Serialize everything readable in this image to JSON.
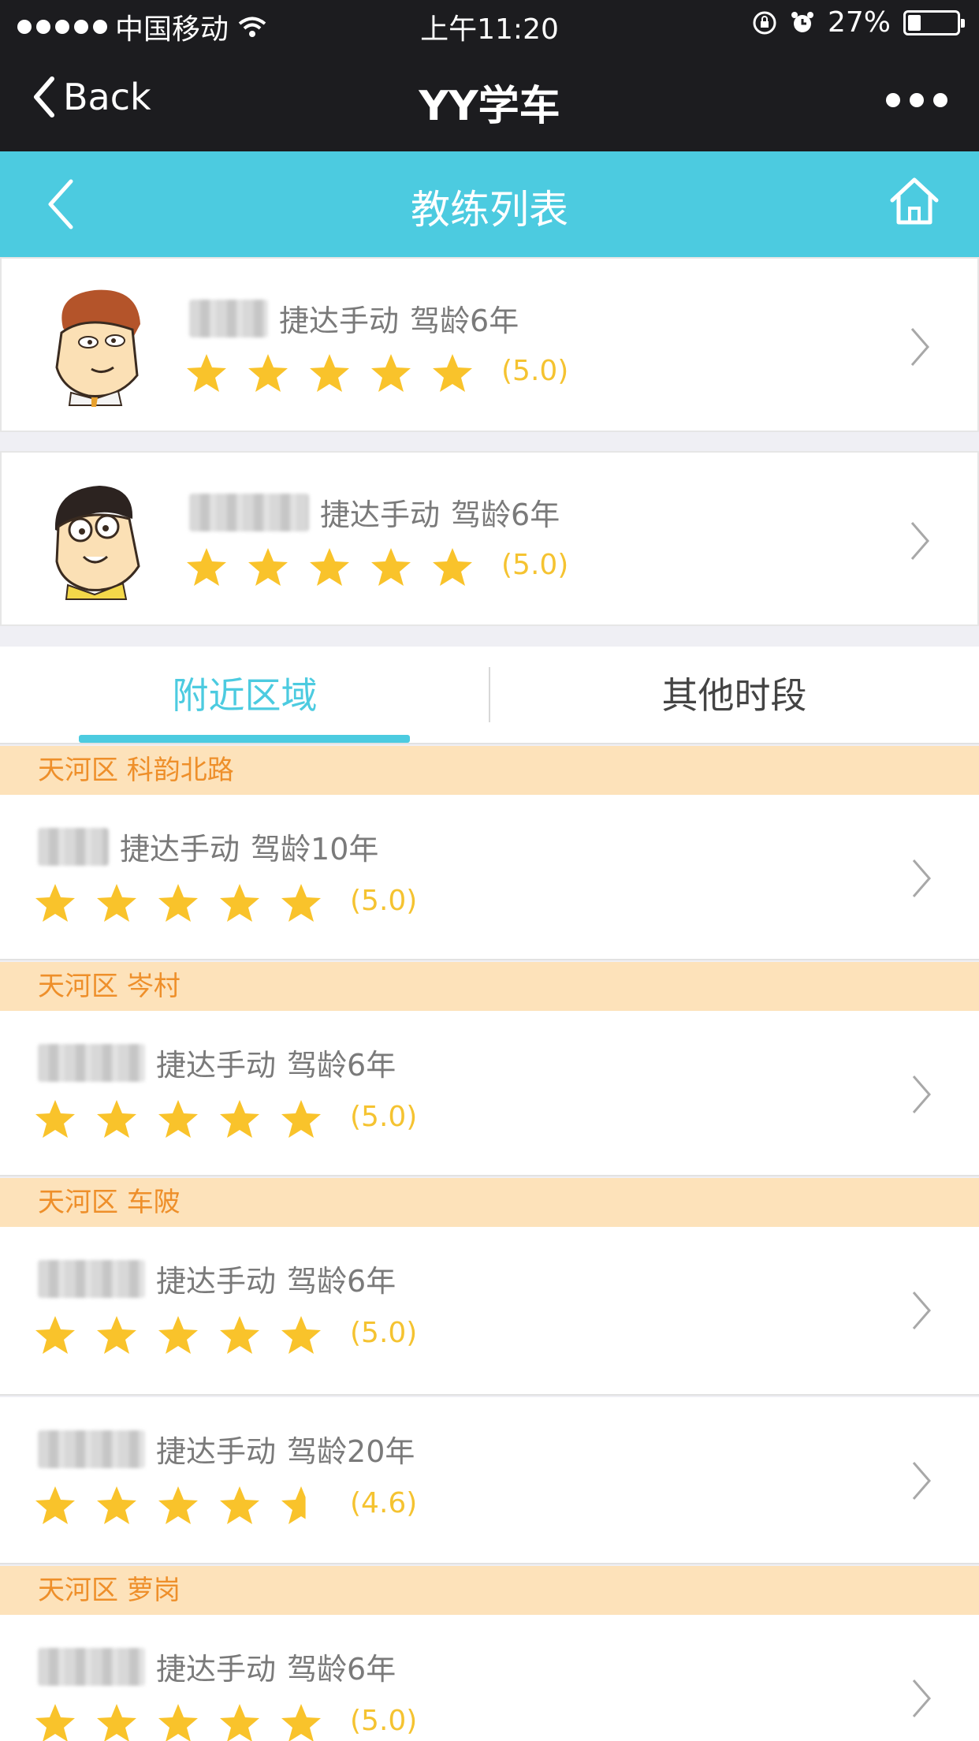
{
  "status_bar": {
    "carrier": "中国移动",
    "time": "上午11:20",
    "battery_text": "27%",
    "battery_level": 0.27
  },
  "nav": {
    "back_label": "Back",
    "title": "YY学车"
  },
  "header": {
    "title": "教练列表"
  },
  "featured": [
    {
      "car": "捷达手动",
      "experience": "驾龄6年",
      "rating": "(5.0)",
      "stars": 5
    },
    {
      "car": "捷达手动",
      "experience": "驾龄6年",
      "rating": "(5.0)",
      "stars": 5
    }
  ],
  "tabs": [
    {
      "label": "附近区域",
      "active": true
    },
    {
      "label": "其他时段",
      "active": false
    }
  ],
  "sections": [
    {
      "label": "天河区 科韵北路"
    },
    {
      "label": "天河区 岑村"
    },
    {
      "label": "天河区 车陂"
    },
    {
      "label": "天河区 萝岗"
    }
  ],
  "coaches": [
    {
      "car": "捷达手动",
      "experience": "驾龄10年",
      "rating": "(5.0)",
      "stars": 5
    },
    {
      "car": "捷达手动",
      "experience": "驾龄6年",
      "rating": "(5.0)",
      "stars": 5
    },
    {
      "car": "捷达手动",
      "experience": "驾龄6年",
      "rating": "(5.0)",
      "stars": 5
    },
    {
      "car": "捷达手动",
      "experience": "驾龄20年",
      "rating": "(4.6)",
      "stars": 4.6
    },
    {
      "car": "捷达手动",
      "experience": "驾龄6年",
      "rating": "(5.0)",
      "stars": 5
    }
  ],
  "colors": {
    "accent": "#4ccbe0",
    "star": "#f9c32b",
    "section_bg": "#fde2ba",
    "section_text": "#ee8f2a",
    "bar_dark": "#1c1c1f"
  }
}
